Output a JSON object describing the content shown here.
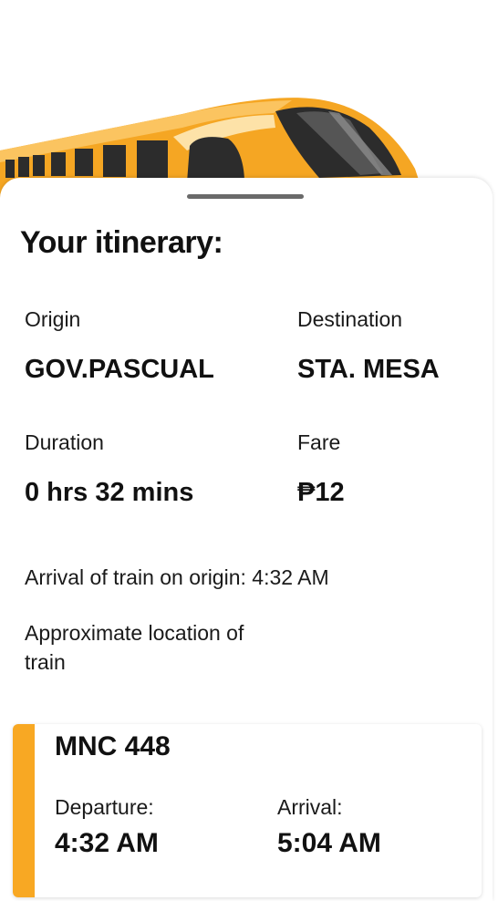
{
  "itinerary": {
    "title": "Your itinerary:",
    "origin_label": "Origin",
    "origin_value": "GOV.PASCUAL",
    "destination_label": "Destination",
    "destination_value": "STA. MESA",
    "duration_label": "Duration",
    "duration_value": "0 hrs 32 mins",
    "fare_label": "Fare",
    "fare_value": "₱12",
    "arrival_text": "Arrival of train on origin: 4:32 AM",
    "approx_location_text": "Approximate location of train"
  },
  "train_card": {
    "name": "MNC 448",
    "departure_label": "Departure:",
    "departure_time": "4:32 AM",
    "arrival_label": "Arrival:",
    "arrival_time": "5:04 AM",
    "accent_color": "#f8a823"
  },
  "hero": {
    "icon": "train-illustration",
    "train_color": "#f5a623"
  }
}
